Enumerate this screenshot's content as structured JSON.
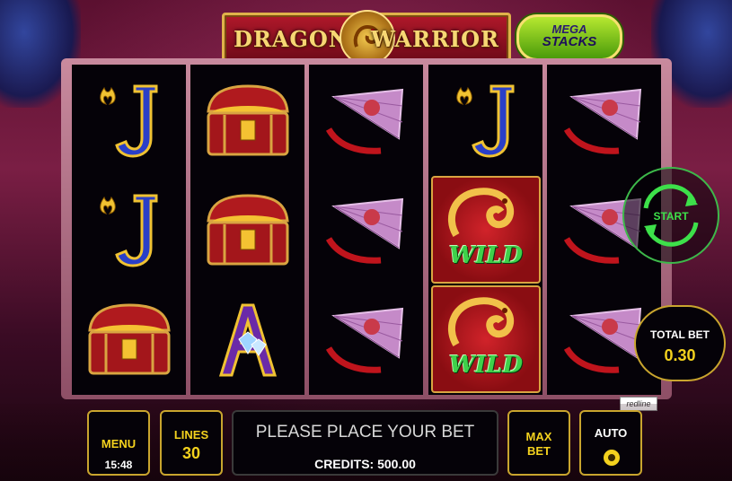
{
  "game": {
    "title_left": "DRAGON",
    "title_right": "WARRIOR",
    "badge_line1": "MEGA",
    "badge_line2": "STACKS",
    "provider": "redline"
  },
  "reels": [
    [
      "jack",
      "jack",
      "chest"
    ],
    [
      "chest",
      "chest",
      "ace"
    ],
    [
      "fan",
      "fan",
      "fan"
    ],
    [
      "jack",
      "wild",
      "wild"
    ],
    [
      "fan",
      "fan",
      "fan"
    ]
  ],
  "wild_label": "WILD",
  "controls": {
    "menu_label": "MENU",
    "clock": "15:48",
    "lines_label": "LINES",
    "lines_value": "30",
    "message": "PLEASE PLACE YOUR BET",
    "credits_label": "CREDITS:",
    "credits_value": "500.00",
    "max_label_1": "MAX",
    "max_label_2": "BET",
    "auto_label": "AUTO",
    "start_label": "START",
    "total_bet_label": "TOTAL BET",
    "total_bet_value": "0.30"
  },
  "colors": {
    "accent_gold": "#c9a52e",
    "text_yellow": "#f4d21e",
    "start_green": "#3db84a",
    "wild_green": "#3fd14a"
  }
}
